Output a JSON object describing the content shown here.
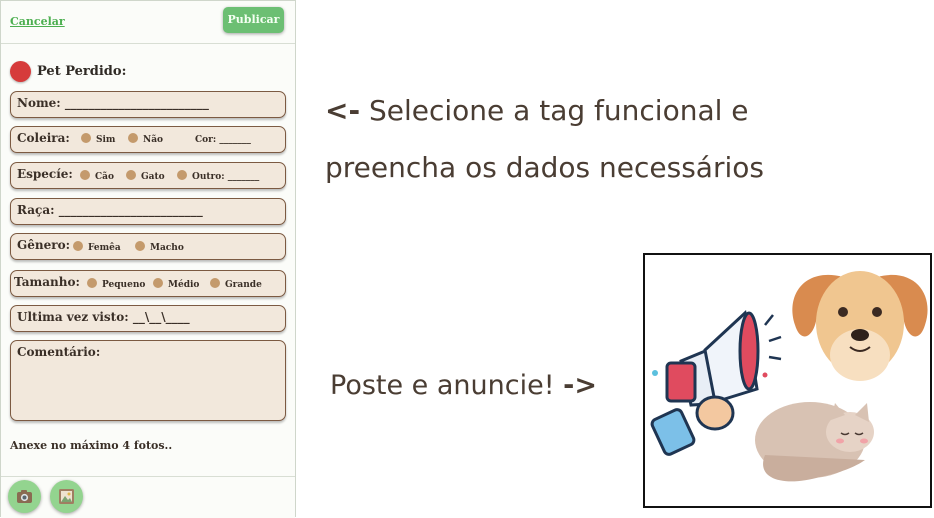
{
  "form": {
    "cancel_label": "Cancelar",
    "publish_label": "Publicar",
    "tag_label": "Pet Perdido:",
    "tag_color": "#d63b3b",
    "nome": "Nome: ________________________",
    "coleira": {
      "label": "Coleira:",
      "options": [
        "Sim",
        "Não"
      ],
      "cor": "Cor: _______"
    },
    "especie": {
      "label": "Especíe:",
      "options": [
        "Cão",
        "Gato",
        "Outro: _______"
      ]
    },
    "raca": "Raça: ________________________",
    "genero": {
      "label": "Gênero:",
      "options": [
        "Femêa",
        "Macho"
      ]
    },
    "tamanho": {
      "label": "Tamanho:",
      "options": [
        "Pequeno",
        "Médio",
        "Grande"
      ]
    },
    "ultima": "Ultima vez visto: __\\__\\____",
    "comentario": "Comentário:",
    "attach_note": "Anexe no máximo 4 fotos..",
    "camera_icon": "camera-icon",
    "gallery_icon": "gallery-icon"
  },
  "instructions": {
    "arrow_left": "<-",
    "line1": "Selecione a tag funcional e",
    "line2": "preencha os dados necessários",
    "poste": "Poste e anuncie!",
    "arrow_right": "->"
  },
  "colors": {
    "accent_green": "#6cbf73",
    "field_bg": "#f2e8dc",
    "field_border": "#7c5a42",
    "text": "#4a3d33"
  }
}
